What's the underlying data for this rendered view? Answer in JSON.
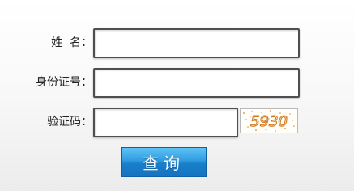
{
  "form": {
    "name_label": "姓  名：",
    "id_label": "身份证号：",
    "captcha_label": "验证码：",
    "name_value": "",
    "id_value": "",
    "captcha_value": "",
    "captcha_text": "5930",
    "query_button": "查询"
  },
  "colors": {
    "button_top": "#5fc2f5",
    "button_bottom": "#1673bf",
    "captcha_text": "#d07a1e",
    "field_border": "#4f4f4f"
  }
}
